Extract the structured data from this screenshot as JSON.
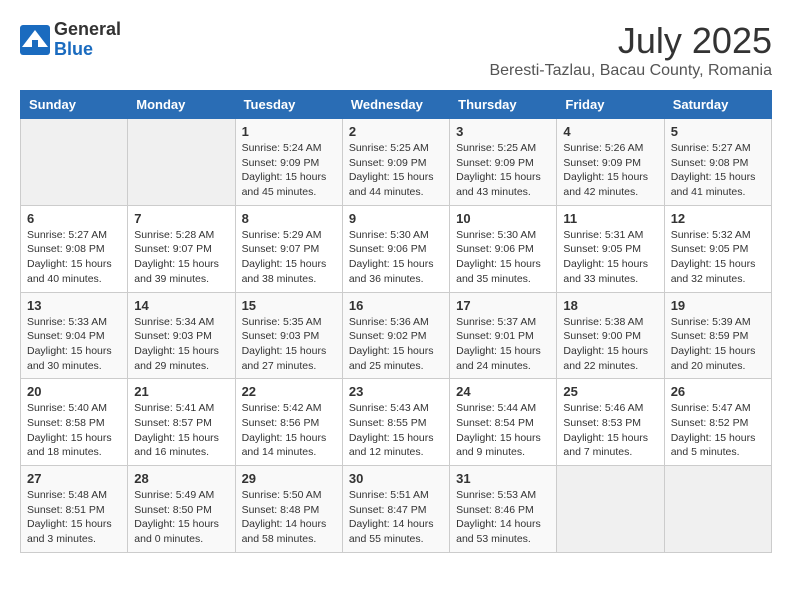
{
  "header": {
    "logo_general": "General",
    "logo_blue": "Blue",
    "month_title": "July 2025",
    "location": "Beresti-Tazlau, Bacau County, Romania"
  },
  "weekdays": [
    "Sunday",
    "Monday",
    "Tuesday",
    "Wednesday",
    "Thursday",
    "Friday",
    "Saturday"
  ],
  "weeks": [
    [
      {
        "day": "",
        "empty": true
      },
      {
        "day": "",
        "empty": true
      },
      {
        "day": "1",
        "sunrise": "5:24 AM",
        "sunset": "9:09 PM",
        "daylight": "15 hours and 45 minutes."
      },
      {
        "day": "2",
        "sunrise": "5:25 AM",
        "sunset": "9:09 PM",
        "daylight": "15 hours and 44 minutes."
      },
      {
        "day": "3",
        "sunrise": "5:25 AM",
        "sunset": "9:09 PM",
        "daylight": "15 hours and 43 minutes."
      },
      {
        "day": "4",
        "sunrise": "5:26 AM",
        "sunset": "9:09 PM",
        "daylight": "15 hours and 42 minutes."
      },
      {
        "day": "5",
        "sunrise": "5:27 AM",
        "sunset": "9:08 PM",
        "daylight": "15 hours and 41 minutes."
      }
    ],
    [
      {
        "day": "6",
        "sunrise": "5:27 AM",
        "sunset": "9:08 PM",
        "daylight": "15 hours and 40 minutes."
      },
      {
        "day": "7",
        "sunrise": "5:28 AM",
        "sunset": "9:07 PM",
        "daylight": "15 hours and 39 minutes."
      },
      {
        "day": "8",
        "sunrise": "5:29 AM",
        "sunset": "9:07 PM",
        "daylight": "15 hours and 38 minutes."
      },
      {
        "day": "9",
        "sunrise": "5:30 AM",
        "sunset": "9:06 PM",
        "daylight": "15 hours and 36 minutes."
      },
      {
        "day": "10",
        "sunrise": "5:30 AM",
        "sunset": "9:06 PM",
        "daylight": "15 hours and 35 minutes."
      },
      {
        "day": "11",
        "sunrise": "5:31 AM",
        "sunset": "9:05 PM",
        "daylight": "15 hours and 33 minutes."
      },
      {
        "day": "12",
        "sunrise": "5:32 AM",
        "sunset": "9:05 PM",
        "daylight": "15 hours and 32 minutes."
      }
    ],
    [
      {
        "day": "13",
        "sunrise": "5:33 AM",
        "sunset": "9:04 PM",
        "daylight": "15 hours and 30 minutes."
      },
      {
        "day": "14",
        "sunrise": "5:34 AM",
        "sunset": "9:03 PM",
        "daylight": "15 hours and 29 minutes."
      },
      {
        "day": "15",
        "sunrise": "5:35 AM",
        "sunset": "9:03 PM",
        "daylight": "15 hours and 27 minutes."
      },
      {
        "day": "16",
        "sunrise": "5:36 AM",
        "sunset": "9:02 PM",
        "daylight": "15 hours and 25 minutes."
      },
      {
        "day": "17",
        "sunrise": "5:37 AM",
        "sunset": "9:01 PM",
        "daylight": "15 hours and 24 minutes."
      },
      {
        "day": "18",
        "sunrise": "5:38 AM",
        "sunset": "9:00 PM",
        "daylight": "15 hours and 22 minutes."
      },
      {
        "day": "19",
        "sunrise": "5:39 AM",
        "sunset": "8:59 PM",
        "daylight": "15 hours and 20 minutes."
      }
    ],
    [
      {
        "day": "20",
        "sunrise": "5:40 AM",
        "sunset": "8:58 PM",
        "daylight": "15 hours and 18 minutes."
      },
      {
        "day": "21",
        "sunrise": "5:41 AM",
        "sunset": "8:57 PM",
        "daylight": "15 hours and 16 minutes."
      },
      {
        "day": "22",
        "sunrise": "5:42 AM",
        "sunset": "8:56 PM",
        "daylight": "15 hours and 14 minutes."
      },
      {
        "day": "23",
        "sunrise": "5:43 AM",
        "sunset": "8:55 PM",
        "daylight": "15 hours and 12 minutes."
      },
      {
        "day": "24",
        "sunrise": "5:44 AM",
        "sunset": "8:54 PM",
        "daylight": "15 hours and 9 minutes."
      },
      {
        "day": "25",
        "sunrise": "5:46 AM",
        "sunset": "8:53 PM",
        "daylight": "15 hours and 7 minutes."
      },
      {
        "day": "26",
        "sunrise": "5:47 AM",
        "sunset": "8:52 PM",
        "daylight": "15 hours and 5 minutes."
      }
    ],
    [
      {
        "day": "27",
        "sunrise": "5:48 AM",
        "sunset": "8:51 PM",
        "daylight": "15 hours and 3 minutes."
      },
      {
        "day": "28",
        "sunrise": "5:49 AM",
        "sunset": "8:50 PM",
        "daylight": "15 hours and 0 minutes."
      },
      {
        "day": "29",
        "sunrise": "5:50 AM",
        "sunset": "8:48 PM",
        "daylight": "14 hours and 58 minutes."
      },
      {
        "day": "30",
        "sunrise": "5:51 AM",
        "sunset": "8:47 PM",
        "daylight": "14 hours and 55 minutes."
      },
      {
        "day": "31",
        "sunrise": "5:53 AM",
        "sunset": "8:46 PM",
        "daylight": "14 hours and 53 minutes."
      },
      {
        "day": "",
        "empty": true
      },
      {
        "day": "",
        "empty": true
      }
    ]
  ]
}
